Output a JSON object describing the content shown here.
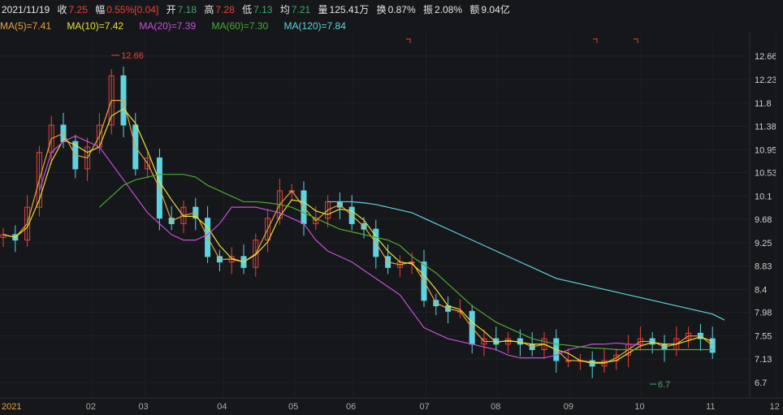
{
  "header": {
    "date": "2021/11/19",
    "close_label": "收",
    "close": "7.25",
    "chg_label": "幅",
    "chg": "0.55%[0.04]",
    "open_label": "开",
    "open": "7.18",
    "high_label": "高",
    "high": "7.28",
    "low_label": "低",
    "low": "7.13",
    "avg_label": "均",
    "avg": "7.21",
    "vol_label": "量",
    "vol": "125.41万",
    "turn_label": "换",
    "turn": "0.87%",
    "amp_label": "振",
    "amp": "2.08%",
    "amt_label": "额",
    "amt": "9.04亿"
  },
  "ma_legend": [
    {
      "label": "MA(5)=7.41",
      "color": "#e8a33a"
    },
    {
      "label": "MA(10)=7.42",
      "color": "#e8e03a"
    },
    {
      "label": "MA(20)=7.39",
      "color": "#c84fd8"
    },
    {
      "label": "MA(60)=7.30",
      "color": "#4caa30"
    },
    {
      "label": "MA(120)=7.84",
      "color": "#5fd3df"
    }
  ],
  "chart_data": {
    "type": "candlestick",
    "y_ticks": [
      "12.66",
      "12.23",
      "11.8",
      "11.38",
      "10.95",
      "10.53",
      "10.1",
      "9.68",
      "9.25",
      "8.83",
      "8.4",
      "7.98",
      "7.55",
      "7.13",
      "6.7"
    ],
    "ylim": [
      6.7,
      12.66
    ],
    "x_ticks": [
      {
        "label": "2021",
        "t": 0.03
      },
      {
        "label": "02",
        "t": 0.12
      },
      {
        "label": "03",
        "t": 0.19
      },
      {
        "label": "04",
        "t": 0.295
      },
      {
        "label": "05",
        "t": 0.39
      },
      {
        "label": "06",
        "t": 0.467
      },
      {
        "label": "07",
        "t": 0.565
      },
      {
        "label": "08",
        "t": 0.66
      },
      {
        "label": "09",
        "t": 0.757
      },
      {
        "label": "10",
        "t": 0.852
      },
      {
        "label": "11",
        "t": 0.947
      },
      {
        "label": "12",
        "t": 1.032
      }
    ],
    "closes": [
      9.4,
      9.3,
      9.9,
      10.9,
      11.4,
      11.1,
      10.6,
      11.0,
      11.4,
      12.3,
      11.4,
      10.6,
      10.8,
      9.7,
      9.6,
      9.9,
      9.7,
      9.0,
      8.9,
      9.0,
      8.8,
      9.3,
      9.7,
      10.2,
      10.2,
      9.6,
      9.7,
      10.0,
      9.9,
      9.6,
      9.5,
      9.0,
      8.8,
      8.9,
      8.9,
      8.2,
      8.1,
      8.0,
      8.0,
      7.4,
      7.5,
      7.4,
      7.5,
      7.4,
      7.3,
      7.5,
      7.1,
      7.1,
      7.1,
      7.0,
      7.1,
      7.2,
      7.4,
      7.5,
      7.4,
      7.3,
      7.5,
      7.6,
      7.5,
      7.25
    ],
    "ma20": {
      "start": 3,
      "values": [
        10.2,
        10.9,
        11.1,
        11.2,
        11.1,
        11.0,
        10.7,
        10.4,
        10.1,
        9.8,
        9.6,
        9.4,
        9.3,
        9.3,
        9.4,
        9.6,
        9.9,
        9.9,
        9.9,
        9.85,
        9.8,
        9.7,
        9.6,
        9.3,
        9.1,
        9.0,
        8.9,
        8.75,
        8.6,
        8.45,
        8.3,
        8.0,
        7.7,
        7.6,
        7.5,
        7.45,
        7.4,
        7.35,
        7.3,
        7.2,
        7.15,
        7.15,
        7.15,
        7.2,
        7.3,
        7.35,
        7.4,
        7.4,
        7.42,
        7.4,
        7.39
      ]
    },
    "ma60": {
      "start": 8,
      "values": [
        9.9,
        10.1,
        10.3,
        10.4,
        10.45,
        10.5,
        10.5,
        10.5,
        10.45,
        10.3,
        10.2,
        10.1,
        10.0,
        10.0,
        9.98,
        9.95,
        9.9,
        9.8,
        9.7,
        9.6,
        9.5,
        9.45,
        9.4,
        9.35,
        9.3,
        9.2,
        9.0,
        8.85,
        8.7,
        8.5,
        8.3,
        8.1,
        7.95,
        7.8,
        7.7,
        7.6,
        7.5,
        7.45,
        7.4,
        7.38,
        7.35,
        7.33,
        7.32,
        7.3,
        7.3,
        7.3,
        7.3,
        7.3,
        7.3,
        7.3,
        7.3,
        7.3
      ]
    },
    "ma120": {
      "start": 27,
      "values": [
        10.0,
        10.0,
        10.0,
        9.98,
        9.95,
        9.9,
        9.85,
        9.8,
        9.7,
        9.6,
        9.5,
        9.4,
        9.3,
        9.2,
        9.1,
        9.0,
        8.9,
        8.8,
        8.7,
        8.6,
        8.55,
        8.5,
        8.45,
        8.4,
        8.35,
        8.3,
        8.25,
        8.2,
        8.15,
        8.1,
        8.05,
        8.0,
        7.95,
        7.84
      ]
    },
    "max_label": "12.66",
    "min_label": "6.7"
  }
}
